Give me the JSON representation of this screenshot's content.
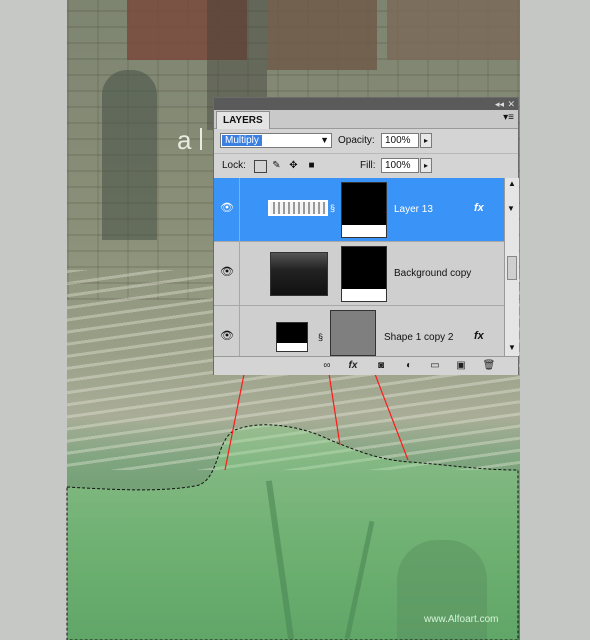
{
  "canvas": {
    "typed_letter": "a",
    "watermark": "www.Alfoart.com"
  },
  "panel": {
    "title": "LAYERS",
    "collapse_icon": "double-arrow-icon",
    "close_icon": "close-icon",
    "menu_icon": "panel-menu-icon",
    "blend_mode": "Multiply",
    "opacity_label": "Opacity:",
    "opacity_value": "100%",
    "lock_label": "Lock:",
    "fill_label": "Fill:",
    "fill_value": "100%",
    "lock_icons": [
      "lock-transparent-icon",
      "lock-image-icon",
      "lock-position-icon",
      "lock-all-icon"
    ],
    "layers": [
      {
        "name": "Layer 13",
        "fx": "fx",
        "selected": true
      },
      {
        "name": "Background copy",
        "fx": "",
        "selected": false
      },
      {
        "name": "Shape 1 copy 2",
        "fx": "fx",
        "selected": false
      }
    ],
    "bottom_icons": [
      "link-layers-icon",
      "fx-icon",
      "add-mask-icon",
      "adjustment-layer-icon",
      "new-group-icon",
      "new-layer-icon",
      "trash-icon"
    ]
  },
  "colors": {
    "selected_layer": "#3a93f7",
    "pointer_lines": "#ff1a1a"
  }
}
